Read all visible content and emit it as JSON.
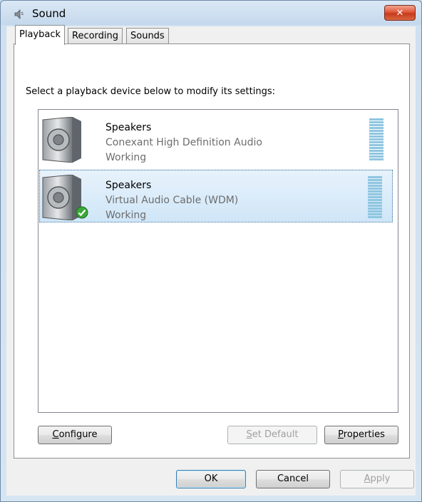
{
  "window": {
    "title": "Sound",
    "close_glyph": "✕"
  },
  "tabs": [
    {
      "label": "Playback",
      "active": true
    },
    {
      "label": "Recording",
      "active": false
    },
    {
      "label": "Sounds",
      "active": false
    }
  ],
  "instructions": "Select a playback device below to modify its settings:",
  "devices": [
    {
      "name": "Speakers",
      "driver": "Conexant High Definition Audio",
      "status": "Working",
      "selected": false,
      "default": false
    },
    {
      "name": "Speakers",
      "driver": "Virtual Audio Cable (WDM)",
      "status": "Working",
      "selected": true,
      "default": true
    }
  ],
  "buttons": {
    "configure": {
      "label": "Configure",
      "mnemonic": "C",
      "rest": "onfigure"
    },
    "set_default": {
      "label": "Set Default",
      "mnemonic": "S",
      "rest": "et Default"
    },
    "properties": {
      "label": "Properties",
      "mnemonic": "P",
      "rest": "roperties"
    },
    "ok": "OK",
    "cancel": "Cancel",
    "apply": {
      "label": "Apply",
      "mnemonic": "A",
      "rest": "pply"
    }
  },
  "colors": {
    "accent": "#3a6e9f",
    "meter": "#8fc6e0",
    "close": "#d9573b"
  }
}
